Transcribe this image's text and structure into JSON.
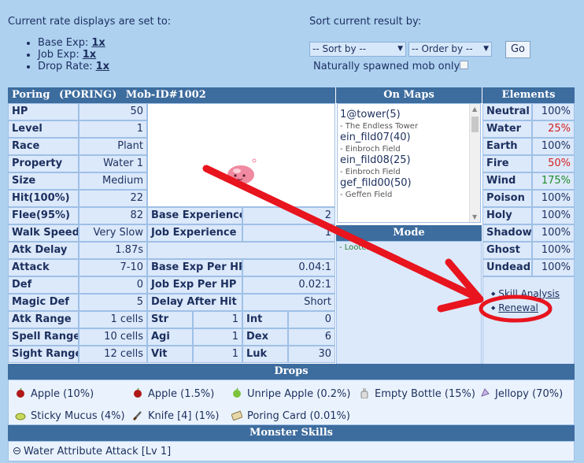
{
  "rates": {
    "title": "Current rate displays are set to:",
    "items": [
      {
        "label": "Base Exp:",
        "value": "1x"
      },
      {
        "label": "Job Exp:",
        "value": "1x"
      },
      {
        "label": "Drop Rate:",
        "value": "1x"
      }
    ]
  },
  "sort": {
    "title": "Sort current result by:",
    "sort_by": "-- Sort by --",
    "order_by": "-- Order by --",
    "go": "Go",
    "spawn_label": "Naturally spawned mob only?"
  },
  "mob": {
    "name": "Poring",
    "sprite_name": "(PORING)",
    "id": "Mob-ID#1002"
  },
  "stats_left": [
    {
      "label": "HP",
      "value": "50"
    },
    {
      "label": "Level",
      "value": "1"
    },
    {
      "label": "Race",
      "value": "Plant"
    },
    {
      "label": "Property",
      "value": "Water 1"
    },
    {
      "label": "Size",
      "value": "Medium"
    },
    {
      "label": "Hit(100%)",
      "value": "22"
    },
    {
      "label": "Flee(95%)",
      "value": "82"
    },
    {
      "label": "Walk Speed",
      "value": "Very Slow"
    },
    {
      "label": "Atk Delay",
      "value": "1.87s"
    },
    {
      "label": "Attack",
      "value": "7-10"
    },
    {
      "label": "Def",
      "value": "0"
    },
    {
      "label": "Magic Def",
      "value": "5"
    },
    {
      "label": "Atk Range",
      "value": "1 cells"
    },
    {
      "label": "Spell Range",
      "value": "10 cells"
    },
    {
      "label": "Sight Range",
      "value": "12 cells"
    }
  ],
  "stats_mid": [
    {
      "label": "Base Experience",
      "value": "2"
    },
    {
      "label": "Job Experience",
      "value": "1"
    },
    {
      "label": "",
      "value": ""
    },
    {
      "label": "Base Exp Per HP",
      "value": "0.04:1"
    },
    {
      "label": "Job Exp Per HP",
      "value": "0.02:1"
    },
    {
      "label": "Delay After Hit",
      "value": "Short"
    }
  ],
  "attrs": [
    {
      "label": "Str",
      "value": "1",
      "label2": "Int",
      "value2": "0"
    },
    {
      "label": "Agi",
      "value": "1",
      "label2": "Dex",
      "value2": "6"
    },
    {
      "label": "Vit",
      "value": "1",
      "label2": "Luk",
      "value2": "30"
    }
  ],
  "maps": {
    "title": "On Maps",
    "items": [
      {
        "name": "1@tower(5)",
        "desc": "- The Endless Tower"
      },
      {
        "name": "ein_fild07(40)",
        "desc": "- Einbroch Field"
      },
      {
        "name": "ein_fild08(25)",
        "desc": "- Einbroch Field"
      },
      {
        "name": "gef_fild00(50)",
        "desc": "- Geffen Field"
      }
    ]
  },
  "mode": {
    "title": "Mode",
    "items": [
      "- Looter"
    ]
  },
  "elements": {
    "title": "Elements",
    "items": [
      {
        "label": "Neutral",
        "value": "100%",
        "tone": ""
      },
      {
        "label": "Water",
        "value": "25%",
        "tone": "red"
      },
      {
        "label": "Earth",
        "value": "100%",
        "tone": ""
      },
      {
        "label": "Fire",
        "value": "50%",
        "tone": "red"
      },
      {
        "label": "Wind",
        "value": "175%",
        "tone": "green"
      },
      {
        "label": "Poison",
        "value": "100%",
        "tone": ""
      },
      {
        "label": "Holy",
        "value": "100%",
        "tone": ""
      },
      {
        "label": "Shadow",
        "value": "100%",
        "tone": ""
      },
      {
        "label": "Ghost",
        "value": "100%",
        "tone": ""
      },
      {
        "label": "Undead",
        "value": "100%",
        "tone": ""
      }
    ]
  },
  "links": {
    "skill_analysis": "Skill Analysis",
    "renewal": "Renewal"
  },
  "drops": {
    "title": "Drops",
    "items": [
      {
        "name": "Apple",
        "rate": "(10%)",
        "icon": "apple-icon"
      },
      {
        "name": "Apple",
        "rate": "(1.5%)",
        "icon": "apple-icon"
      },
      {
        "name": "Unripe Apple",
        "rate": "(0.2%)",
        "icon": "green-apple-icon"
      },
      {
        "name": "Empty Bottle",
        "rate": "(15%)",
        "icon": "bottle-icon"
      },
      {
        "name": "Jellopy",
        "rate": "(70%)",
        "icon": "jellopy-icon"
      },
      {
        "name": "Sticky Mucus",
        "rate": "(4%)",
        "icon": "mucus-icon"
      },
      {
        "name": "Knife [4]",
        "rate": "(1%)",
        "icon": "knife-icon"
      },
      {
        "name": "Poring Card",
        "rate": "(0.01%)",
        "icon": "card-icon"
      }
    ]
  },
  "skills": {
    "title": "Monster Skills",
    "items": [
      "Water Attribute Attack [Lv 1]"
    ]
  },
  "colors": {
    "header_bg": "#3d6c9e",
    "cell_bg": "#dce9fb",
    "page_bg": "#aed1f0",
    "annotation": "#e8141e"
  }
}
